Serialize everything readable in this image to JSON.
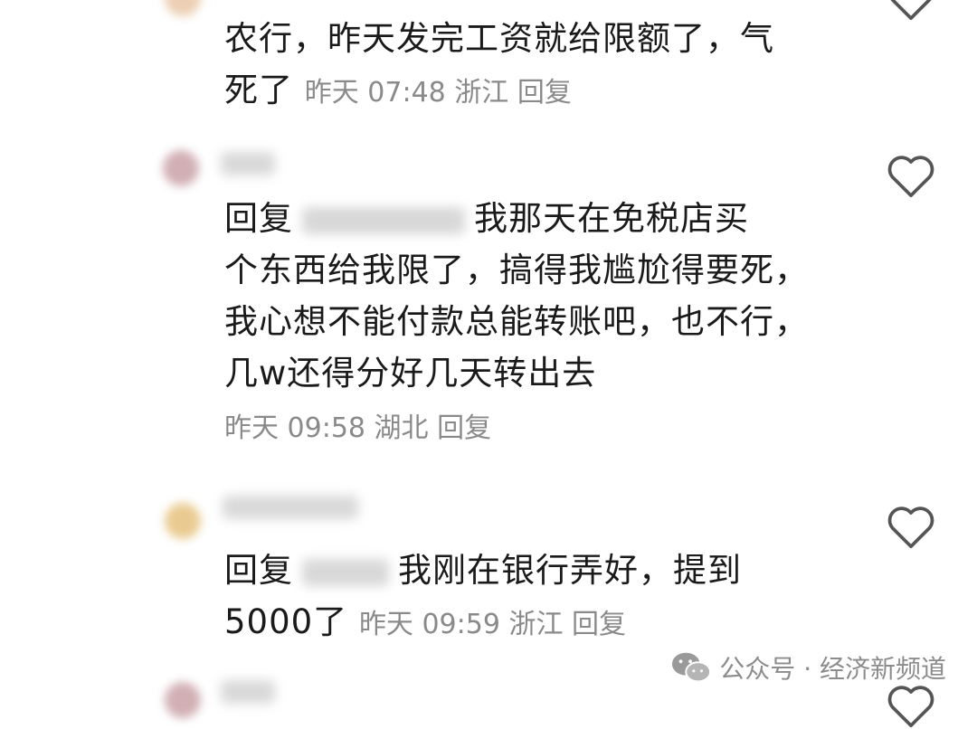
{
  "comments": [
    {
      "body_line1": "农行，昨天发完工资就给限额了，气",
      "body_line2": "死了",
      "time": "昨天 07:48",
      "location": "浙江",
      "reply_label": "回复"
    },
    {
      "reply_prefix": "回复",
      "body_line1": "我那天在免税店买",
      "body_line2": "个东西给我限了，搞得我尴尬得要死，",
      "body_line3": "我心想不能付款总能转账吧，也不行，",
      "body_line4": "几w还得分好几天转出去",
      "time": "昨天 09:58",
      "location": "湖北",
      "reply_label": "回复"
    },
    {
      "reply_prefix": "回复",
      "body_line1": "我刚在银行弄好，提到",
      "body_line2": "5000了",
      "time": "昨天 09:59",
      "location": "浙江",
      "reply_label": "回复"
    }
  ],
  "watermark": {
    "text": "公众号 · 经济新频道"
  },
  "colors": {
    "text": "#1a1a1a",
    "meta": "#8a8a8a",
    "heart_stroke": "#555555"
  },
  "icons": [
    "heart-icon",
    "wechat-icon"
  ]
}
